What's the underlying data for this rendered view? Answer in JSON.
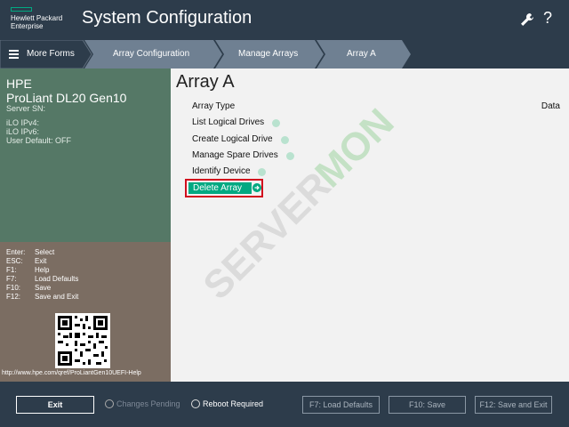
{
  "header": {
    "logo_line1": "Hewlett Packard",
    "logo_line2": "Enterprise",
    "title": "System Configuration",
    "help_glyph": "?"
  },
  "nav": {
    "more_forms": "More Forms",
    "crumbs": [
      "Array Configuration",
      "Manage Arrays",
      "Array A"
    ]
  },
  "server": {
    "vendor": "HPE",
    "model": "ProLiant DL20 Gen10",
    "serial_label": "Server SN:",
    "ilo_ipv4": "iLO IPv4:",
    "ilo_ipv6": "iLO IPv6:",
    "user_default": "User Default: OFF"
  },
  "keys": [
    {
      "key": "Enter:",
      "action": "Select"
    },
    {
      "key": "ESC:",
      "action": "Exit"
    },
    {
      "key": "F1:",
      "action": "Help"
    },
    {
      "key": "F7:",
      "action": "Load Defaults"
    },
    {
      "key": "F10:",
      "action": "Save"
    },
    {
      "key": "F12:",
      "action": "Save and Exit"
    }
  ],
  "help_url": "http://www.hpe.com/qref/ProLiantGen10UEFI-Help",
  "main": {
    "title": "Array A",
    "array_type_label": "Array Type",
    "array_type_value": "Data",
    "actions": [
      "List Logical Drives",
      "Create Logical Drive",
      "Manage Spare Drives",
      "Identify Device"
    ],
    "delete_label": "Delete Array"
  },
  "watermark": {
    "line1": "SERVER",
    "line2": "MON"
  },
  "footer": {
    "exit": "Exit",
    "changes_pending": "Changes Pending",
    "reboot_required": "Reboot Required",
    "f7": "F7: Load Defaults",
    "f10": "F10: Save",
    "f12": "F12: Save and Exit"
  },
  "colors": {
    "brand_green": "#01a982",
    "highlight_red": "#d10f1e",
    "header_bg": "#2d3c4b",
    "info_panel": "#557866",
    "keys_panel": "#7b6d62"
  }
}
